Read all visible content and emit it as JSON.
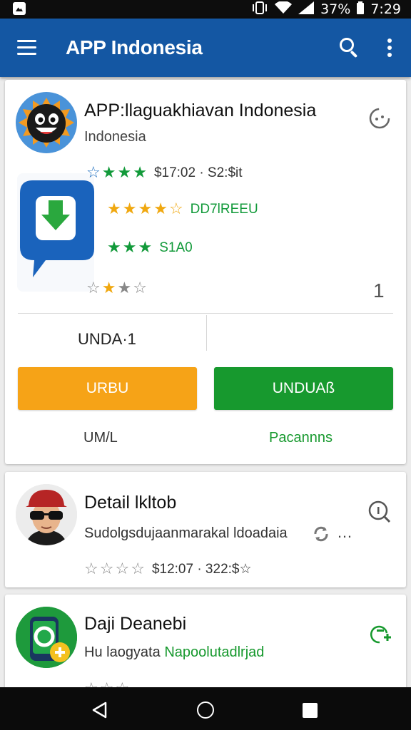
{
  "status_bar": {
    "battery": "37%",
    "time": "7:29",
    "icons": [
      "image-notification-icon",
      "vibrate-icon",
      "wifi-icon",
      "signal-icon"
    ]
  },
  "app_bar": {
    "title": "APP Indonesia",
    "color": "#1457a3",
    "icons": [
      "menu-icon",
      "search-icon",
      "more-vert-icon"
    ]
  },
  "featured": {
    "title": "APP:llaguakhiavan Indonesia",
    "subtitle": "Indonesia",
    "ratings": [
      {
        "text": "$17:02 · S2:$it"
      },
      {
        "text": "DD7lREEU"
      },
      {
        "text": "S1A0"
      },
      {
        "text": ""
      }
    ],
    "count": "1",
    "stat_label": "UNDA·1",
    "buttons": {
      "secondary": "URBU",
      "primary": "UNDUAß"
    },
    "footer_left": "UM/L",
    "footer_right": "Pacannns",
    "colors": {
      "orange": "#f6a317",
      "green": "#17992e"
    }
  },
  "items": [
    {
      "title": "Detail lkltob",
      "subtitle": "Sudolgsdujaanmarakal ldoadaia",
      "more": "…",
      "rating_text": "$12:07 · 322:$☆"
    },
    {
      "title": "Daji Deanebi",
      "subtitle_prefix": "Hu laogyata",
      "subtitle_highlight": "Napoolutadlrjad"
    }
  ],
  "nav_bar": {
    "icons": [
      "back-icon",
      "home-icon",
      "recents-icon"
    ]
  }
}
